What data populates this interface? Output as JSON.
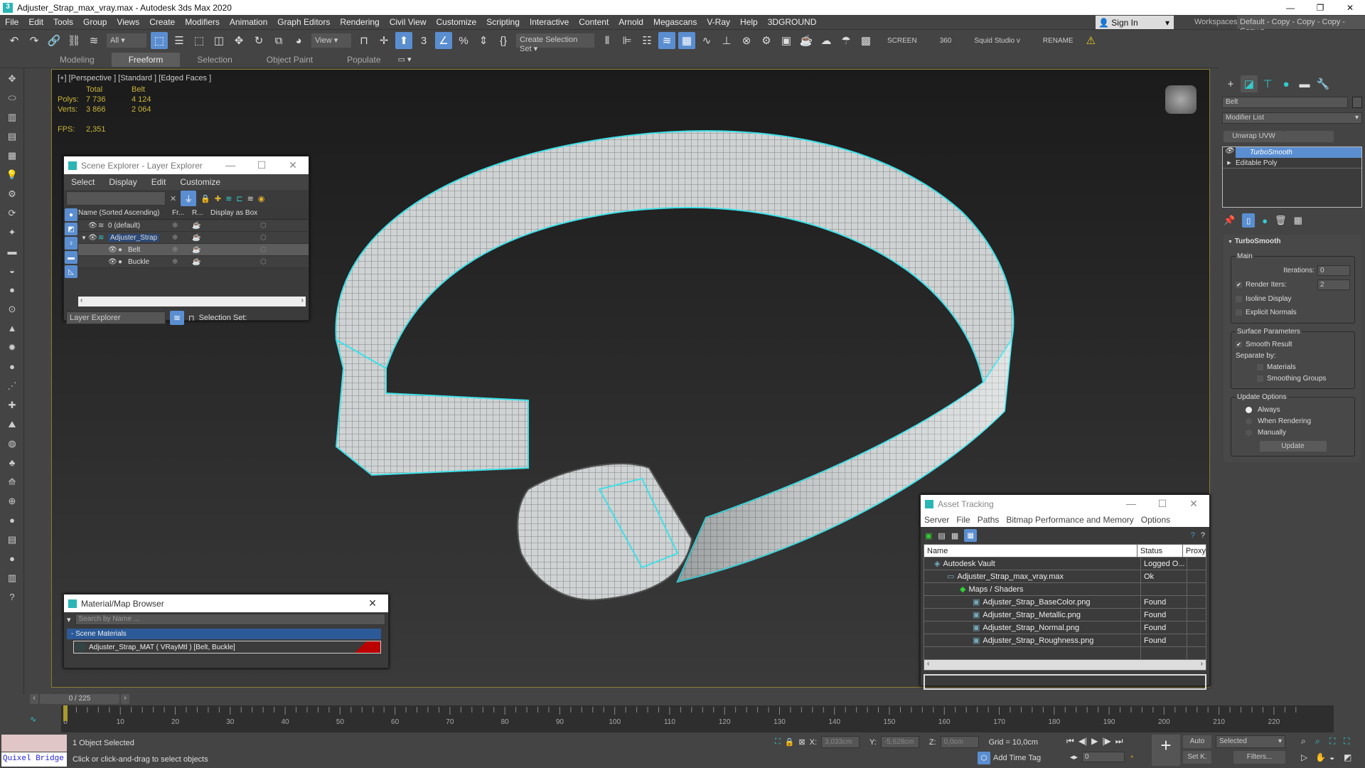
{
  "window": {
    "title": "Adjuster_Strap_max_vray.max - Autodesk 3ds Max 2020",
    "app_icon": "3"
  },
  "menubar": {
    "items": [
      "File",
      "Edit",
      "Tools",
      "Group",
      "Views",
      "Create",
      "Modifiers",
      "Animation",
      "Graph Editors",
      "Rendering",
      "Civil View",
      "Customize",
      "Scripting",
      "Interactive",
      "Content",
      "Arnold",
      "Megascans",
      "V-Ray",
      "Help",
      "3DGROUND"
    ],
    "sign_in": "Sign In",
    "workspaces_label": "Workspaces:",
    "workspace": "Default - Copy - Copy - Copy - Copy"
  },
  "toolbar": {
    "filter": "All",
    "ref_coord": "View",
    "selection_set": "Create Selection Set",
    "screen": "SCREEN",
    "three_sixty": "360",
    "squid": "Squid Studio v",
    "rename": "RENAME",
    "icons": [
      "undo-icon",
      "redo-icon",
      "link-icon",
      "unlink-icon",
      "bind-spacewarp-icon"
    ],
    "icons2": [
      "select-object-icon",
      "select-by-name-icon",
      "rect-selection-icon",
      "window-crossing-icon",
      "move-icon",
      "rotate-icon",
      "scale-icon",
      "place-icon"
    ],
    "icons3": [
      "pivot-icon",
      "manipulate-icon",
      "keyboard-shortcut-icon",
      "snap-3d-icon",
      "angle-snap-icon",
      "percent-snap-icon",
      "spinner-snap-icon",
      "edit-named-sets-icon"
    ],
    "icons4": [
      "mirror-icon",
      "align-icon",
      "scene-explorer-icon",
      "layer-explorer-icon",
      "ribbon-toggle-icon",
      "curve-editor-icon",
      "schematic-view-icon",
      "material-editor-icon",
      "render-setup-icon",
      "rendered-frame-icon",
      "render-icon",
      "render-cloud-icon",
      "render-a360-icon",
      "vray-icon"
    ]
  },
  "ribbon": {
    "tabs": [
      "Modeling",
      "Freeform",
      "Selection",
      "Object Paint",
      "Populate"
    ],
    "active": "Freeform"
  },
  "viewport": {
    "label": "[+] [Perspective ] [Standard ] [Edged Faces ]",
    "stats": {
      "col_total": "Total",
      "col_obj": "Belt",
      "polys_label": "Polys:",
      "polys_total": "7 736",
      "polys_obj": "4 124",
      "verts_label": "Verts:",
      "verts_total": "3 866",
      "verts_obj": "2 064",
      "fps_label": "FPS:",
      "fps": "2,351"
    }
  },
  "scene_explorer": {
    "title": "Scene Explorer - Layer Explorer",
    "menu": [
      "Select",
      "Display",
      "Edit",
      "Customize"
    ],
    "columns": [
      "Name (Sorted Ascending)",
      "Fr...",
      "R...",
      "Display as Box"
    ],
    "rows": [
      {
        "name": "0 (default)",
        "level": 0
      },
      {
        "name": "Adjuster_Strap",
        "level": 0
      },
      {
        "name": "Belt",
        "level": 1
      },
      {
        "name": "Buckle",
        "level": 1
      }
    ],
    "explorer": "Layer Explorer",
    "selection_set": "Selection Set:"
  },
  "material_browser": {
    "title": "Material/Map Browser",
    "search_placeholder": "Search by Name ...",
    "group": "- Scene Materials",
    "item": "Adjuster_Strap_MAT  ( VRayMtl ) [Belt, Buckle]"
  },
  "asset_tracking": {
    "title": "Asset Tracking",
    "menu": [
      "Server",
      "File",
      "Paths",
      "Bitmap Performance and Memory",
      "Options"
    ],
    "columns": [
      "Name",
      "Status",
      "Proxy"
    ],
    "rows": [
      {
        "name": "Autodesk Vault",
        "status": "Logged O...",
        "indent": 1
      },
      {
        "name": "Adjuster_Strap_max_vray.max",
        "status": "Ok",
        "indent": 2
      },
      {
        "name": "Maps / Shaders",
        "status": "",
        "indent": 3
      },
      {
        "name": "Adjuster_Strap_BaseColor.png",
        "status": "Found",
        "indent": 4
      },
      {
        "name": "Adjuster_Strap_Metallic.png",
        "status": "Found",
        "indent": 4
      },
      {
        "name": "Adjuster_Strap_Normal.png",
        "status": "Found",
        "indent": 4
      },
      {
        "name": "Adjuster_Strap_Roughness.png",
        "status": "Found",
        "indent": 4
      }
    ]
  },
  "command_panel": {
    "object_name": "Belt",
    "modifier_list": "Modifier List",
    "unwrap": "Unwrap UVW",
    "stack": [
      "TurboSmooth",
      "Editable Poly"
    ],
    "rollout": "TurboSmooth",
    "main": "Main",
    "iterations_label": "Iterations:",
    "iterations": "0",
    "render_iters_label": "Render Iters:",
    "render_iters": "2",
    "isoline": "Isoline Display",
    "explicit": "Explicit Normals",
    "surface": "Surface Parameters",
    "smooth_result": "Smooth Result",
    "separate": "Separate by:",
    "materials": "Materials",
    "smoothing": "Smoothing Groups",
    "update_options": "Update Options",
    "always": "Always",
    "when_rendering": "When Rendering",
    "manually": "Manually",
    "update": "Update"
  },
  "timeline": {
    "frame": "0 / 225",
    "max": 225,
    "current": 0
  },
  "status": {
    "quixel": "Quixel Bridge",
    "selected": "1 Object Selected",
    "prompt": "Click or click-and-drag to select objects",
    "x_label": "X:",
    "x": "3,033cm",
    "y_label": "Y:",
    "y": "-5,628cm",
    "z_label": "Z:",
    "z": "0,0cm",
    "grid": "Grid = 10,0cm",
    "add_time_tag": "Add Time Tag",
    "frame_field": "0",
    "auto": "Auto",
    "setk": "Set K.",
    "key_filter": "Selected",
    "filters": "Filters..."
  },
  "colors": {
    "accent": "#5a8ed0",
    "wire": "#3ee0e8",
    "stat": "#c8b43c",
    "viewport_border": "#8a7a30"
  }
}
